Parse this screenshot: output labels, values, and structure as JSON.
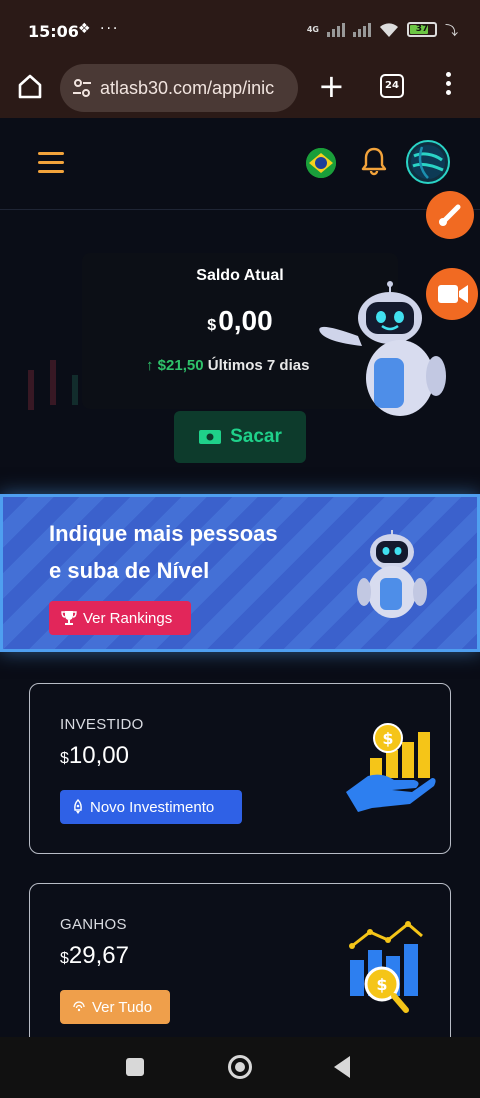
{
  "status_bar": {
    "time": "15:06",
    "battery": "37",
    "network": "4G"
  },
  "browser": {
    "url": "atlasb30.com/app/inic",
    "tab_count": "24"
  },
  "balance": {
    "title": "Saldo Atual",
    "currency": "$",
    "value": "0,00",
    "change": "$21,50",
    "change_period": "Últimos 7 dias",
    "withdraw_label": "Sacar"
  },
  "banner": {
    "title_line1": "Indique mais pessoas",
    "title_line2": "e suba de Nível",
    "button_label": "Ver Rankings"
  },
  "cards": {
    "invested": {
      "label": "INVESTIDO",
      "currency": "$",
      "value": "10,00",
      "button_label": "Novo Investimento"
    },
    "gains": {
      "label": "GANHOS",
      "currency": "$",
      "value": "29,67",
      "button_label": "Ver Tudo"
    }
  },
  "colors": {
    "accent_orange": "#f3a33b",
    "positive_green": "#2fc26b",
    "banner_blue": "#3b61cc",
    "ranking_pink": "#e2265a",
    "invest_blue": "#2f61e6",
    "gains_orange": "#ef9f4b"
  }
}
